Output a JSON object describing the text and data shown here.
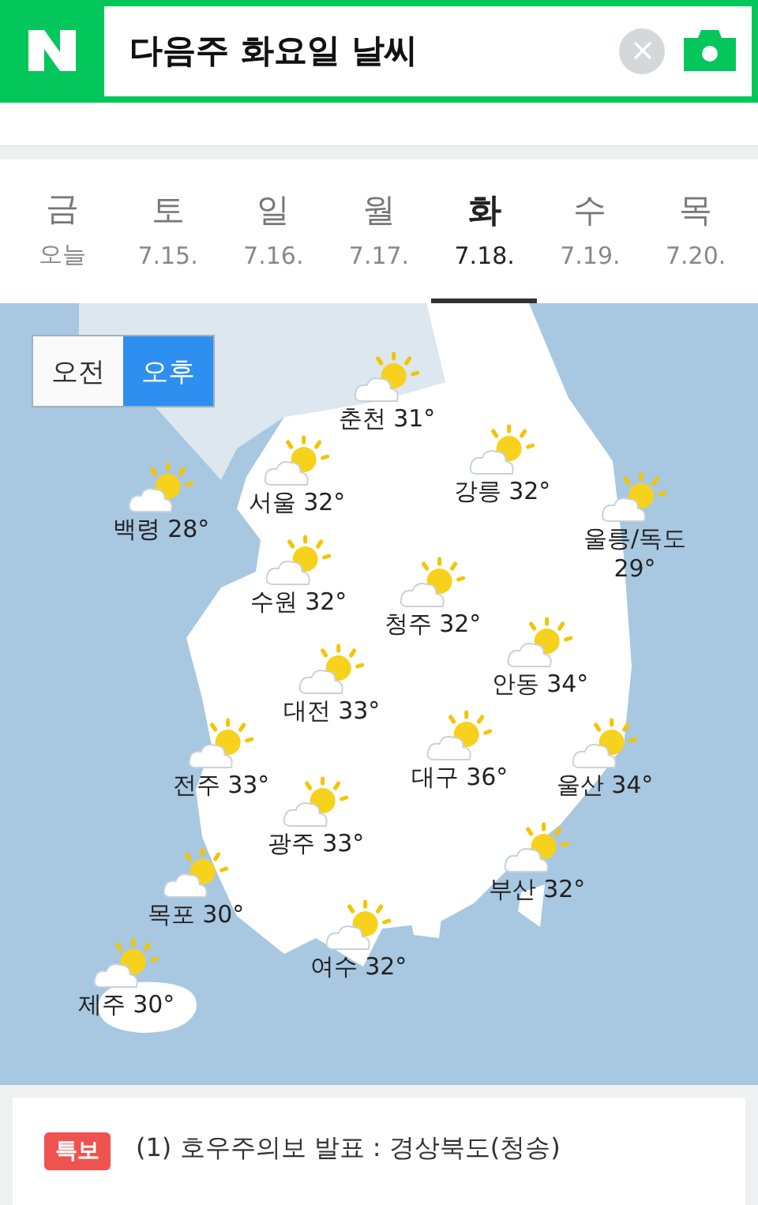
{
  "search": {
    "query": "다음주 화요일 날씨"
  },
  "days": [
    {
      "weekday": "금",
      "date": "오늘",
      "selected": false
    },
    {
      "weekday": "토",
      "date": "7.15.",
      "selected": false
    },
    {
      "weekday": "일",
      "date": "7.16.",
      "selected": false
    },
    {
      "weekday": "월",
      "date": "7.17.",
      "selected": false
    },
    {
      "weekday": "화",
      "date": "7.18.",
      "selected": true
    },
    {
      "weekday": "수",
      "date": "7.19.",
      "selected": false
    },
    {
      "weekday": "목",
      "date": "7.20.",
      "selected": false
    }
  ],
  "period_toggle": [
    {
      "label": "오전",
      "selected": false
    },
    {
      "label": "오후",
      "selected": true
    }
  ],
  "cities": [
    {
      "label": "춘천 31°"
    },
    {
      "label": "서울 32°"
    },
    {
      "label": "백령 28°"
    },
    {
      "label": "강릉 32°"
    },
    {
      "label": "울릉/독도 29°"
    },
    {
      "label": "수원 32°"
    },
    {
      "label": "청주 32°"
    },
    {
      "label": "안동 34°"
    },
    {
      "label": "대전 33°"
    },
    {
      "label": "전주 33°"
    },
    {
      "label": "대구 36°"
    },
    {
      "label": "울산 34°"
    },
    {
      "label": "광주 33°"
    },
    {
      "label": "부산 32°"
    },
    {
      "label": "목포 30°"
    },
    {
      "label": "여수 32°"
    },
    {
      "label": "제주 30°"
    }
  ],
  "alert": {
    "badge": "특보",
    "text": "(1) 호우주의보 발표 : 경상북도(청송)"
  }
}
